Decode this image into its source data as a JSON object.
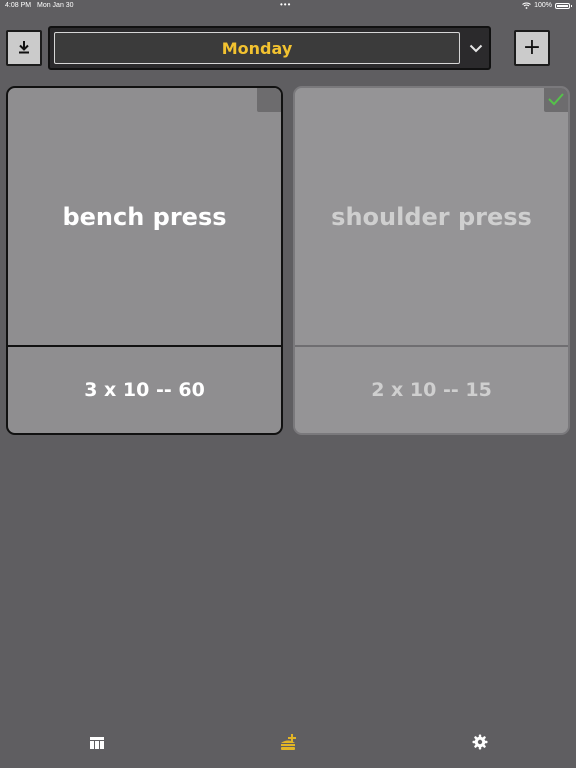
{
  "status_bar": {
    "time": "4:08 PM",
    "date": "Mon Jan 30",
    "dots": "•••",
    "battery": "100%"
  },
  "toolbar": {
    "download_icon": "download-icon",
    "add_label": "+",
    "day_selected": "Monday",
    "day_color": "#f2c230"
  },
  "exercises": [
    {
      "name": "bench press",
      "detail": "3 x 10 -- 60",
      "completed": false
    },
    {
      "name": "shoulder press",
      "detail": "2 x 10 -- 15",
      "completed": true
    }
  ],
  "tab_bar": {
    "tabs": [
      {
        "icon": "table-icon",
        "active": false
      },
      {
        "icon": "workout-icon",
        "active": true,
        "color": "#e2b526"
      },
      {
        "icon": "gear-icon",
        "active": false
      }
    ]
  },
  "colors": {
    "background": "#5f5e61",
    "card": "#8f8e90",
    "check": "#55c24a"
  }
}
